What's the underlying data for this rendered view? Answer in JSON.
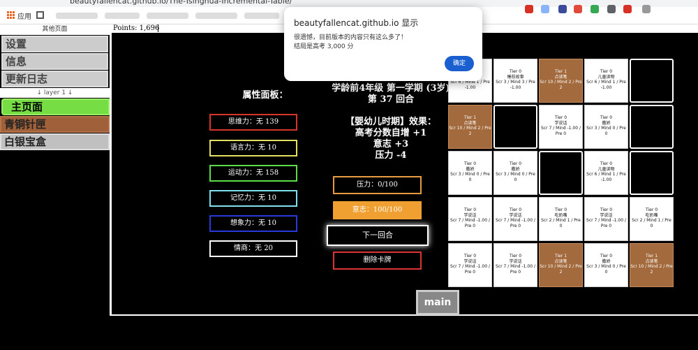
{
  "browser": {
    "url": "beautyfallencat.github.io/The-Tsinghua-Incremental-Table/",
    "apps_label": "应用"
  },
  "sidebar": {
    "header": "其他页面",
    "settings": "设置",
    "info": "信息",
    "changelog": "更新日志",
    "layer": "↓ layer 1 ↓",
    "main_page": "主页面",
    "bronze": "青铜针匣",
    "silver": "白银宝盒"
  },
  "points": "Points: 1,696",
  "attributes": {
    "title": "属性面板：",
    "items": [
      {
        "label": "思维力：无 139",
        "color": "#d8342a"
      },
      {
        "label": "语言力：无 10",
        "color": "#e6e060"
      },
      {
        "label": "运动力：无 158",
        "color": "#5ddc4a"
      },
      {
        "label": "记忆力：无 10",
        "color": "#7fe0f0"
      },
      {
        "label": "想象力：无 10",
        "color": "#2a3ad8"
      },
      {
        "label": "情商：无 20",
        "color": "#ffffff"
      }
    ]
  },
  "status": {
    "grade": "学龄前4年级 第一学期 (3岁)",
    "round": "第 37 回合",
    "effect_title": "【婴幼儿时期】效果：",
    "effect_1": "高考分数自增 +1",
    "effect_2": "意志 +3",
    "effect_3": "压力 -4"
  },
  "buttons": {
    "pressure": "压力：0/100",
    "will": "意志：100/100",
    "next_round": "下一回合",
    "delete_card": "删除卡牌",
    "main_tab": "main"
  },
  "cards": [
    {
      "kind": "w",
      "tier": "Tier 0",
      "name": "睡前故事",
      "stats": "Scr 6 / Mind 1 / Pre -1.00"
    },
    {
      "kind": "w",
      "tier": "Tier 0",
      "name": "睡前故事",
      "stats": "Scr 3 / Mind 3 / Pre -1.00"
    },
    {
      "kind": "b",
      "tier": "Tier 1",
      "name": "点读笔",
      "stats": "Scr 10 / Mind 2 / Pre 2"
    },
    {
      "kind": "w",
      "tier": "Tier 0",
      "name": "儿童读物",
      "stats": "Scr 6 / Mind 1 / Pre -1.00"
    },
    {
      "kind": "k"
    },
    {
      "kind": "b",
      "tier": "Tier 1",
      "name": "点读笔",
      "stats": "Scr 10 / Mind 2 / Pre 2"
    },
    {
      "kind": "k"
    },
    {
      "kind": "w",
      "tier": "Tier 0",
      "name": "学说话",
      "stats": "Scr 7 / Mind -1.00 / Pre 0"
    },
    {
      "kind": "w",
      "tier": "Tier 0",
      "name": "撒娇",
      "stats": "Scr 3 / Mind 0 / Pre 0"
    },
    {
      "kind": "k"
    },
    {
      "kind": "w",
      "tier": "Tier 0",
      "name": "撒娇",
      "stats": "Scr 3 / Mind 0 / Pre 0"
    },
    {
      "kind": "w",
      "tier": "Tier 0",
      "name": "撒娇",
      "stats": "Scr 3 / Mind 0 / Pre 0"
    },
    {
      "kind": "k"
    },
    {
      "kind": "w",
      "tier": "Tier 0",
      "name": "儿童读物",
      "stats": "Scr 6 / Mind 1 / Pre -1.00"
    },
    {
      "kind": "k"
    },
    {
      "kind": "w",
      "tier": "Tier 0",
      "name": "学说话",
      "stats": "Scr 7 / Mind -1.00 / Pre 0"
    },
    {
      "kind": "w",
      "tier": "Tier 0",
      "name": "学说话",
      "stats": "Scr 7 / Mind -1.00 / Pre 0"
    },
    {
      "kind": "w",
      "tier": "Tier 0",
      "name": "吃奶嘴",
      "stats": "Scr 2 / Mind 1 / Pre 0"
    },
    {
      "kind": "w",
      "tier": "Tier 0",
      "name": "学说话",
      "stats": "Scr 7 / Mind -1.00 / Pre 0"
    },
    {
      "kind": "w",
      "tier": "Tier 0",
      "name": "吃奶嘴",
      "stats": "Scr 2 / Mind 1 / Pre 0"
    },
    {
      "kind": "w",
      "tier": "Tier 0",
      "name": "学说话",
      "stats": "Scr 7 / Mind -1.00 / Pre 0"
    },
    {
      "kind": "w",
      "tier": "Tier 0",
      "name": "学说话",
      "stats": "Scr 7 / Mind -1.00 / Pre 0"
    },
    {
      "kind": "b",
      "tier": "Tier 1",
      "name": "点读笔",
      "stats": "Scr 10 / Mind 2 / Pre 2"
    },
    {
      "kind": "w",
      "tier": "Tier 0",
      "name": "撒娇",
      "stats": "Scr 3 / Mind 0 / Pre 0"
    },
    {
      "kind": "b",
      "tier": "Tier 1",
      "name": "点读笔",
      "stats": "Scr 10 / Mind 2 / Pre 2"
    }
  ],
  "dialog": {
    "title": "beautyfallencat.github.io 显示",
    "line1": "很遗憾，目前版本的内容只有这么多了！",
    "line2": "结局是高考 3,000 分",
    "ok": "确定"
  }
}
